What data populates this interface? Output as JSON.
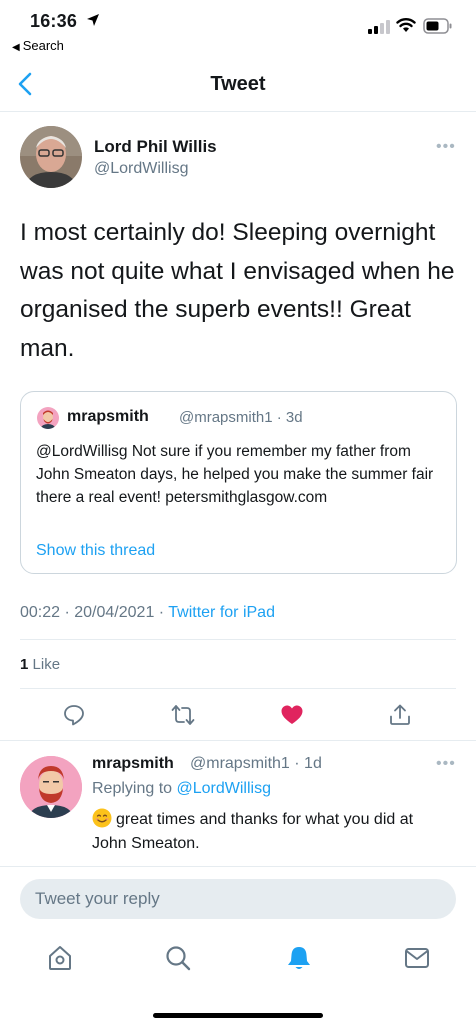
{
  "status_bar": {
    "time": "16:36",
    "back_app": "Search"
  },
  "nav": {
    "title": "Tweet"
  },
  "tweet": {
    "author_name": "Lord Phil Willis",
    "author_handle": "@LordWillisg",
    "text": "I most certainly do! Sleeping overnight was not quite what I envisaged when he organised the superb events!! Great man.",
    "timestamp": "00:22 · 20/04/2021 · ",
    "source": "Twitter for iPad",
    "likes_count": "1",
    "likes_label": "Like"
  },
  "quote": {
    "name": "mrapsmith",
    "handle_time": "@mrapsmith1 · 3d",
    "text": "@LordWillisg Not sure if you remember my father from John Smeaton days, he helped you make the summer fair there a real event! petersmithglasgow.com",
    "show_thread": "Show this thread"
  },
  "reply": {
    "name": "mrapsmith",
    "handle_time": "@mrapsmith1 · 1d",
    "replying_prefix": "Replying to ",
    "replying_mention": "@LordWillisg",
    "text": "great times and thanks for what you did at John Smeaton."
  },
  "compose": {
    "placeholder": "Tweet your reply"
  },
  "icons": {
    "accent": "#1da1f2",
    "like_color": "#e0245e",
    "items": [
      "reply-icon",
      "retweet-icon",
      "like-icon",
      "share-icon",
      "home-icon",
      "search-icon",
      "notifications-icon",
      "messages-icon"
    ]
  }
}
